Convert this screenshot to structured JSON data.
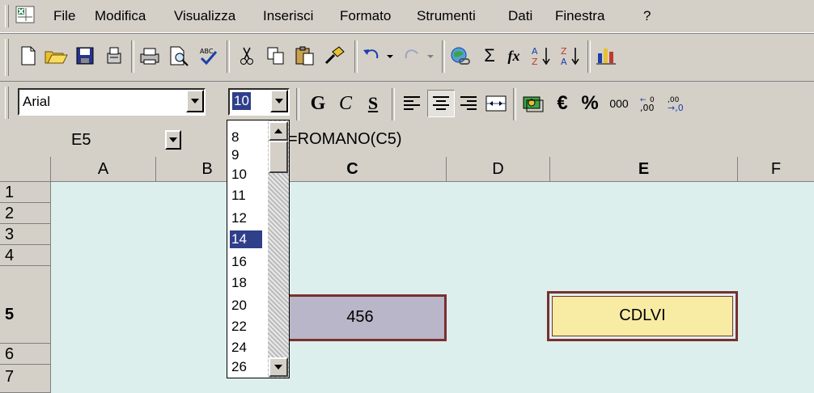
{
  "menubar": {
    "items": [
      "File",
      "Modifica",
      "Visualizza",
      "Inserisci",
      "Formato",
      "Strumenti",
      "Dati",
      "Finestra",
      "?"
    ]
  },
  "format_toolbar": {
    "font_name": "Arial",
    "font_size": "10",
    "bold_label": "G",
    "italic_label": "C",
    "underline_label": "S",
    "euro_label": "€",
    "percent_label": "%",
    "thousands_label": "000"
  },
  "standard_toolbar": {
    "sigma_label": "Σ",
    "fx_label": "fx"
  },
  "formula_bar": {
    "name_box": "E5",
    "formula": "=ROMANO(C5)"
  },
  "font_size_list": {
    "options": [
      "8",
      "9",
      "10",
      "11",
      "12",
      "14",
      "16",
      "18",
      "20",
      "22",
      "24",
      "26"
    ],
    "selected": "14"
  },
  "sheet": {
    "columns": [
      "A",
      "B",
      "C",
      "D",
      "E",
      "F"
    ],
    "rows": [
      "1",
      "2",
      "3",
      "4",
      "5",
      "6",
      "7"
    ],
    "cells": {
      "C5": "456",
      "E5": "CDLVI"
    }
  },
  "colors": {
    "grid_bg": "#dcefec",
    "c5_fill": "#b8b6c8",
    "e5_fill": "#f8eba3",
    "cell_border": "#7a2f2f",
    "list_selection": "#2f3f8a"
  }
}
